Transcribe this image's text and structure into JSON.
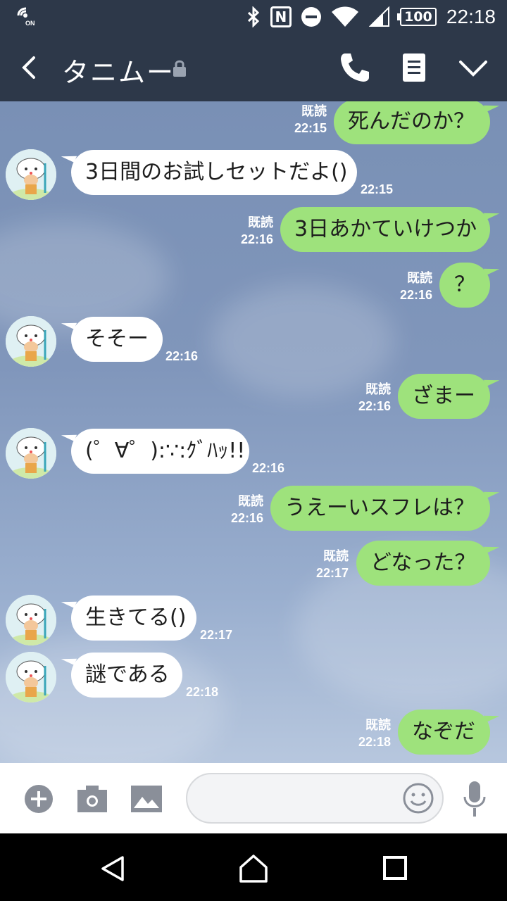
{
  "status_bar": {
    "time": "22:18",
    "battery": "100",
    "nfc_label": "N",
    "icons": [
      "wifi-calling-on-icon",
      "bluetooth-icon",
      "nfc-icon",
      "do-not-disturb-icon",
      "wifi-icon",
      "signal-icon",
      "battery-icon"
    ]
  },
  "header": {
    "title": "タニムー",
    "icons": [
      "back-icon",
      "lock-icon",
      "phone-icon",
      "notes-icon",
      "chevron-down-icon"
    ]
  },
  "messages": [
    {
      "side": "out",
      "text": "死んだのか？",
      "read": "既読",
      "time": "22:15"
    },
    {
      "side": "in",
      "text": "3日間のお試しセットだよ()",
      "time": "22:15"
    },
    {
      "side": "out",
      "text": "3日あかていけつか",
      "read": "既読",
      "time": "22:16"
    },
    {
      "side": "out",
      "text": "？",
      "read": "既読",
      "time": "22:16"
    },
    {
      "side": "in",
      "text": "そそー",
      "time": "22:16"
    },
    {
      "side": "out",
      "text": "ざまー",
      "read": "既読",
      "time": "22:16"
    },
    {
      "side": "in",
      "text": "(゜∀゜):∵:ｸﾞﾊｯ!!",
      "time": "22:16"
    },
    {
      "side": "out",
      "text": "うえーいスフレは？",
      "read": "既読",
      "time": "22:16"
    },
    {
      "side": "out",
      "text": "どなった？",
      "read": "既読",
      "time": "22:17"
    },
    {
      "side": "in",
      "text": "生きてる()",
      "time": "22:17"
    },
    {
      "side": "in",
      "text": "謎である",
      "time": "22:18"
    },
    {
      "side": "out",
      "text": "なぞだ",
      "read": "既読",
      "time": "22:18"
    }
  ],
  "input_bar": {
    "message_value": "",
    "icons": [
      "plus-icon",
      "camera-icon",
      "image-icon",
      "emoji-icon",
      "microphone-icon"
    ]
  },
  "nav_bar": {
    "icons": [
      "nav-back-icon",
      "nav-home-icon",
      "nav-recents-icon"
    ]
  },
  "colors": {
    "header_bg": "#2d3849",
    "outgoing_bubble": "#9ee27c",
    "incoming_bubble": "#ffffff",
    "chat_bg": "#8096bb"
  }
}
